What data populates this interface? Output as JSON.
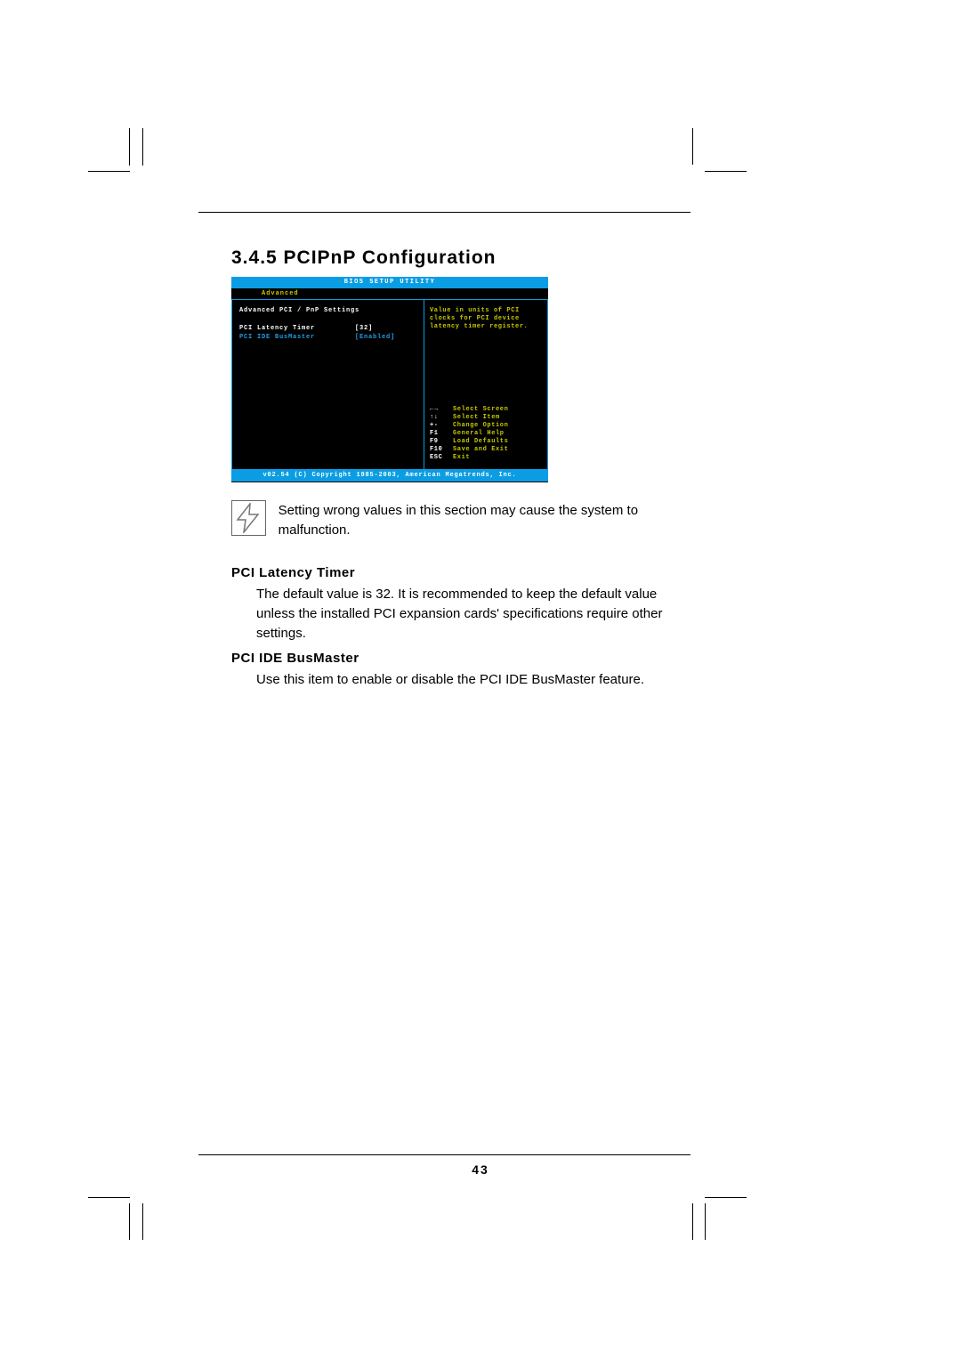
{
  "section_title": "3.4.5 PCIPnP Configuration",
  "bios": {
    "title": "BIOS SETUP UTILITY",
    "tab": "Advanced",
    "section_header": "Advanced PCI / PnP Settings",
    "items": [
      {
        "label": "PCI Latency Timer",
        "value": "[32]",
        "selected": true
      },
      {
        "label": "PCI IDE BusMaster",
        "value": "[Enabled]",
        "selected": false
      }
    ],
    "help_text": "Value in units of PCI clocks for PCI device latency timer register.",
    "nav": [
      {
        "key": "←→",
        "action": "Select Screen"
      },
      {
        "key": "↑↓",
        "action": "Select Item"
      },
      {
        "key": "+-",
        "action": "Change Option"
      },
      {
        "key": "F1",
        "action": "General Help"
      },
      {
        "key": "F9",
        "action": "Load Defaults"
      },
      {
        "key": "F10",
        "action": "Save and Exit"
      },
      {
        "key": "ESC",
        "action": "Exit"
      }
    ],
    "footer": "v02.54 (C) Copyright 1985-2003, American Megatrends, Inc."
  },
  "warning_text": "Setting wrong values in this section may cause the system to malfunction.",
  "descriptions": [
    {
      "heading": "PCI Latency Timer",
      "body": "The default value is 32. It is recommended to keep the default value unless the installed PCI expansion cards' specifications require other settings."
    },
    {
      "heading": "PCI IDE BusMaster",
      "body": "Use this item to enable or disable the PCI IDE BusMaster feature."
    }
  ],
  "page_number": "43"
}
